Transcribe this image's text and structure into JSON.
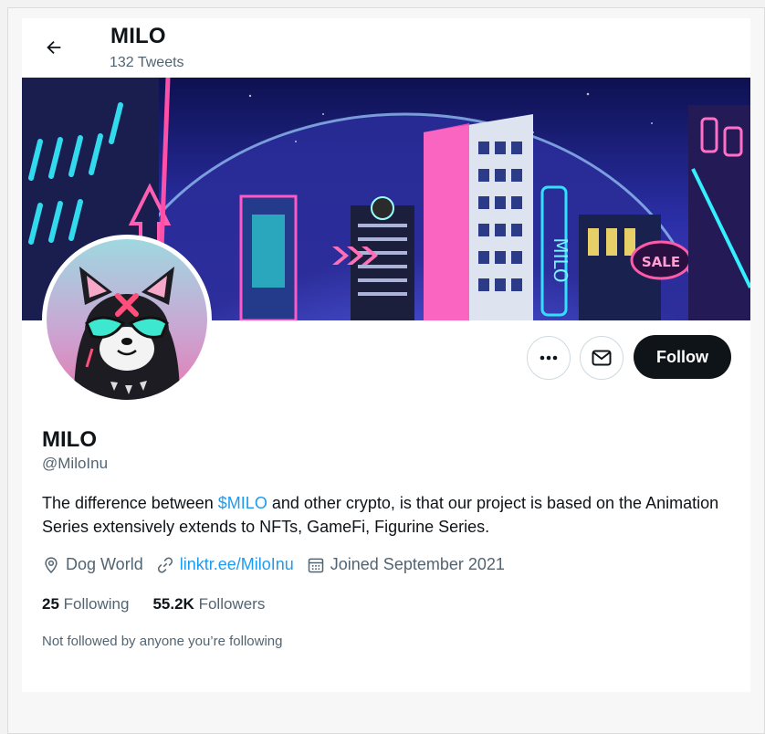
{
  "header": {
    "title": "MILO",
    "tweet_count": "132 Tweets"
  },
  "actions": {
    "follow_label": "Follow"
  },
  "profile": {
    "name": "MILO",
    "handle": "@MiloInu",
    "bio_before": "The difference between ",
    "bio_tag": "$MILO",
    "bio_after": " and other crypto, is that our project is based on the Animation Series extensively extends to NFTs, GameFi, Figurine Series.",
    "location": "Dog World",
    "website": "linktr.ee/MiloInu",
    "joined": "Joined September 2021",
    "following_count": "25",
    "following_label": "Following",
    "followers_count": "55.2K",
    "followers_label": "Followers",
    "not_followed_note": "Not followed by anyone you’re following"
  },
  "banner": {
    "sign_sale": "SALE",
    "sign_milo": "MILO"
  },
  "icons": {
    "back": "arrow-left-icon",
    "more": "ellipsis-icon",
    "message": "envelope-icon",
    "location": "location-pin-icon",
    "link": "link-icon",
    "calendar": "calendar-icon"
  },
  "colors": {
    "accent": "#1d9bf0",
    "primary_text": "#0f1419",
    "secondary_text": "#536471",
    "follow_button": "#0f1419"
  }
}
